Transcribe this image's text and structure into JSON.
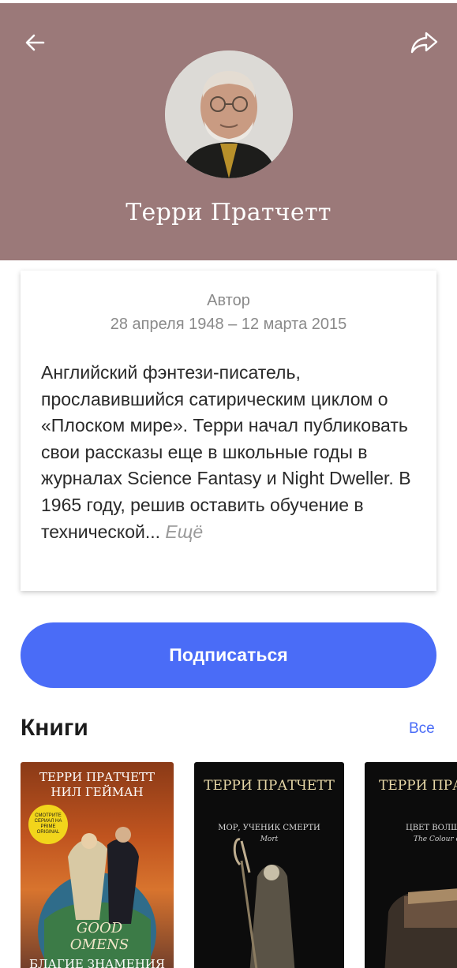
{
  "header": {
    "author_name": "Терри Пратчетт",
    "background": "#9b7979"
  },
  "info": {
    "role": "Автор",
    "dates": "28 апреля 1948 – 12 марта 2015",
    "bio": "Английский фэнтези-писатель, прославившийся сатирическим циклом о «Плоском мире». Терри начал публиковать свои рассказы еще в школьные годы в журналах Science Fantasy и Night Dweller. В 1965 году, решив оставить обучение в технической...",
    "more_label": "Ещё"
  },
  "subscribe": {
    "label": "Подписаться",
    "color": "#4a6cf7"
  },
  "books_section": {
    "title": "Книги",
    "all_label": "Все",
    "books": [
      {
        "author_line_1": "ТЕРРИ ПРАТЧЕТТ",
        "author_line_2": "НИЛ ГЕЙМАН",
        "badge": "СМОТРИТЕ СЕРИАЛ НА PRIME ORIGINAL",
        "logo": "GOOD OMENS",
        "title": "БЛАГИЕ ЗНАМЕНИЯ"
      },
      {
        "author": "ТЕРРИ ПРАТЧЕТТ",
        "title": "МОР, УЧЕНИК СМЕРТИ",
        "subtitle": "Mort"
      },
      {
        "author": "ТЕРРИ ПРА",
        "title": "ЦВЕТ ВОЛШ",
        "subtitle": "The Colour of"
      }
    ]
  },
  "icons": {
    "back": "arrow-left-icon",
    "share": "share-icon"
  }
}
